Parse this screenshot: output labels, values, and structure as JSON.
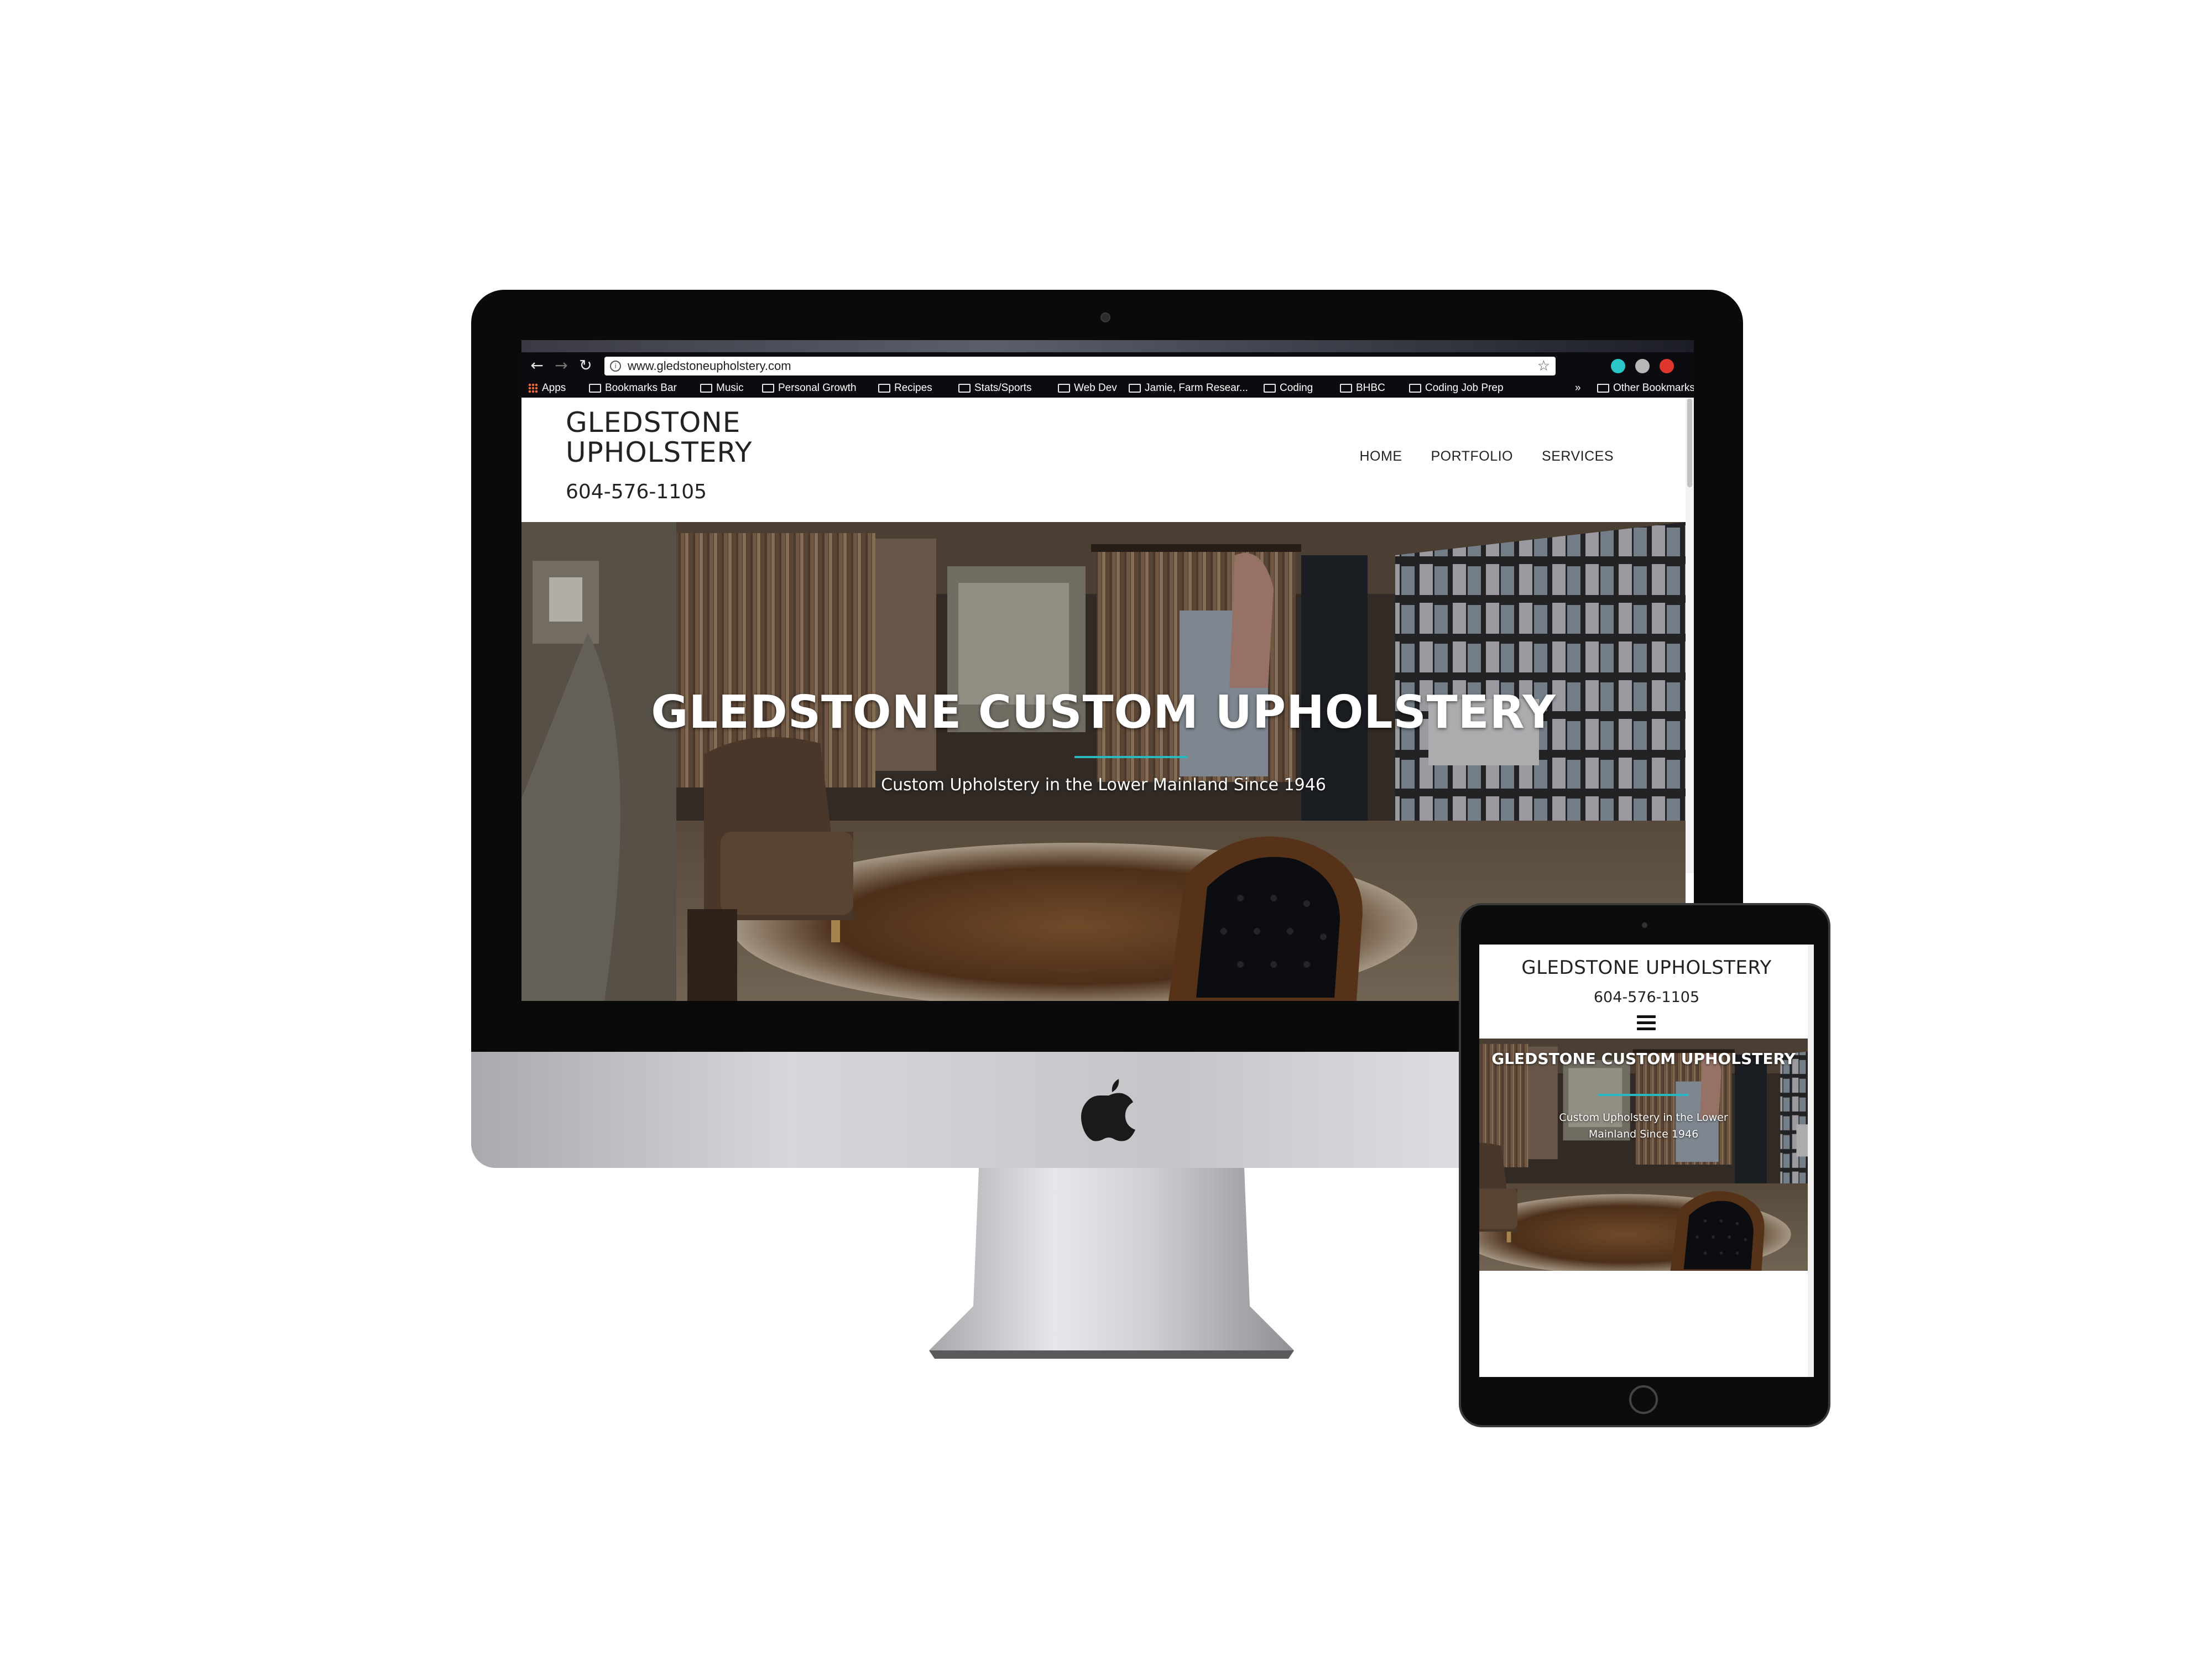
{
  "browser": {
    "url": "www.gledstoneupholstery.com",
    "bookmarks": [
      {
        "label": "Apps",
        "type": "apps"
      },
      {
        "label": "Bookmarks Bar",
        "type": "folder"
      },
      {
        "label": "Music",
        "type": "folder"
      },
      {
        "label": "Personal Growth",
        "type": "folder"
      },
      {
        "label": "Recipes",
        "type": "folder"
      },
      {
        "label": "Stats/Sports",
        "type": "folder"
      },
      {
        "label": "Web Dev",
        "type": "folder"
      },
      {
        "label": "Jamie, Farm Resear...",
        "type": "folder"
      },
      {
        "label": "Coding",
        "type": "folder"
      },
      {
        "label": "BHBC",
        "type": "folder"
      },
      {
        "label": "Coding Job Prep",
        "type": "folder"
      }
    ],
    "overflow_label": "»",
    "other_bookmarks": "Other Bookmarks",
    "extension_colors": [
      "#29c7c7",
      "#b8b8b8",
      "#e0362c"
    ]
  },
  "site": {
    "logo": "GLEDSTONE UPHOLSTERY",
    "phone": "604-576-1105",
    "nav": [
      "HOME",
      "PORTFOLIO",
      "SERVICES"
    ],
    "hero_title": "GLEDSTONE CUSTOM UPHOLSTERY",
    "hero_subtitle": "Custom Upholstery in the Lower Mainland Since 1946",
    "accent_color": "#2ab8c0"
  },
  "tablet": {
    "logo": "GLEDSTONE UPHOLSTERY",
    "phone": "604-576-1105",
    "hero_title": "GLEDSTONE CUSTOM UPHOLSTERY",
    "hero_subtitle": "Custom Upholstery in the Lower Mainland Since 1946",
    "menu_icon": "hamburger-icon"
  }
}
